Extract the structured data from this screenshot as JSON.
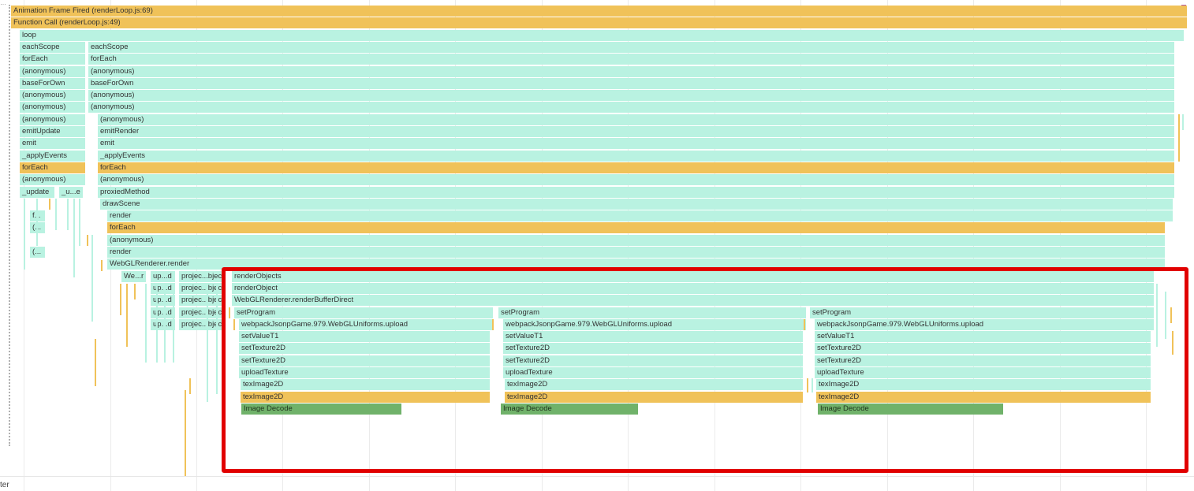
{
  "top_marker": "…",
  "bottom_label": "ter",
  "colors": {
    "teal": "#b9f2e1",
    "orange": "#f0c259",
    "green": "#70b26a",
    "highlight": "#e10000"
  },
  "highlight": {
    "description_color": "#e10000"
  },
  "labels": {
    "animation_frame": "Animation Frame Fired (renderLoop.js:69)",
    "function_call": "Function Call (renderLoop.js:49)",
    "loop": "loop",
    "eachScope": "eachScope",
    "forEach": "forEach",
    "anonymous": "(anonymous)",
    "baseForOwn": "baseForOwn",
    "emitUpdate": "emitUpdate",
    "emitRender": "emitRender",
    "emit": "emit",
    "applyEvents": "_applyEvents",
    "proxiedMethod": "proxiedMethod",
    "update": "_update",
    "u_e": "_u...e",
    "drawScene": "drawScene",
    "render": "render",
    "f_short": "f...",
    "paren_short": "(...",
    "webglrenderer_render": "WebGLRenderer.render",
    "we_r": "We...r",
    "up_d": "up...d",
    "projec_bjects": "projec...bjects",
    "renderObjects": "renderObjects",
    "renderObject": "renderObject",
    "renderBufferDirect": "WebGLRenderer.renderBufferDirect",
    "setProgram": "setProgram",
    "uniforms_upload": "webpackJsonpGame.979.WebGLUniforms.upload",
    "setValueT1": "setValueT1",
    "setTexture2D": "setTexture2D",
    "uploadTexture": "uploadTexture",
    "texImage2D": "texImage2D",
    "imageDecode": "Image Decode"
  }
}
